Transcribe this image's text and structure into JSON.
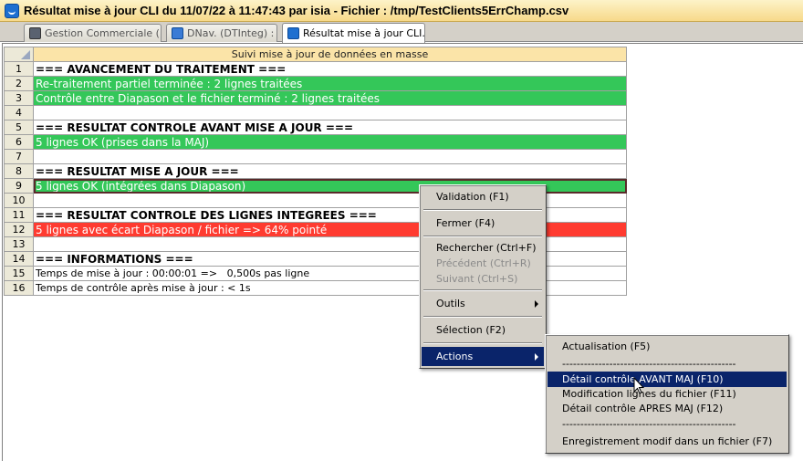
{
  "window": {
    "title": "Résultat mise à jour CLI du 11/07/22 à 11:47:43 par isia - Fichier : /tmp/TestClients5ErrChamp.csv"
  },
  "tabs": [
    {
      "label": "Gestion Commerciale (1..."
    },
    {
      "label": "DNav. (DTInteg) :"
    },
    {
      "label": "Résultat mise à jour CLI..."
    }
  ],
  "grid": {
    "header": "Suivi mise à jour de données en masse",
    "rows": [
      {
        "n": "1",
        "text": "=== AVANCEMENT DU TRAITEMENT ==="
      },
      {
        "n": "2",
        "text": "Re-traitement partiel terminée : 2 lignes traitées"
      },
      {
        "n": "3",
        "text": "Contrôle entre Diapason et le fichier terminé : 2 lignes traitées"
      },
      {
        "n": "4",
        "text": ""
      },
      {
        "n": "5",
        "text": "=== RESULTAT CONTROLE AVANT MISE A JOUR ==="
      },
      {
        "n": "6",
        "text": "5 lignes OK (prises dans la MAJ)"
      },
      {
        "n": "7",
        "text": ""
      },
      {
        "n": "8",
        "text": "=== RESULTAT MISE A JOUR ==="
      },
      {
        "n": "9",
        "text": "5 lignes OK (intégrées dans Diapason)"
      },
      {
        "n": "10",
        "text": ""
      },
      {
        "n": "11",
        "text": "=== RESULTAT CONTROLE DES LIGNES INTEGREES ==="
      },
      {
        "n": "12",
        "text": "5 lignes avec écart Diapason / fichier => 64% pointé"
      },
      {
        "n": "13",
        "text": ""
      },
      {
        "n": "14",
        "text": "=== INFORMATIONS ==="
      },
      {
        "n": "15",
        "text": "Temps de mise à jour : 00:00:01 =>   0,500s pas ligne"
      },
      {
        "n": "16",
        "text": "Temps de contrôle après mise à jour : < 1s"
      }
    ]
  },
  "context_menu": {
    "items": [
      {
        "label": "Validation (F1)"
      },
      {
        "label": "Fermer (F4)"
      },
      {
        "label": "Rechercher (Ctrl+F)"
      },
      {
        "label": "Précédent (Ctrl+R)"
      },
      {
        "label": "Suivant (Ctrl+S)"
      },
      {
        "label": "Outils"
      },
      {
        "label": "Sélection (F2)"
      },
      {
        "label": "Actions"
      }
    ]
  },
  "actions_submenu": {
    "items": [
      {
        "label": "Actualisation  (F5)"
      },
      {
        "label": "------------------------------------------------"
      },
      {
        "label": "Détail contrôle AVANT MAJ  (F10)"
      },
      {
        "label": "Modification lignes du fichier  (F11)"
      },
      {
        "label": "Détail contrôle APRES MAJ  (F12)"
      },
      {
        "label": "------------------------------------------------"
      },
      {
        "label": "Enregistrement modif dans un fichier  (F7)"
      }
    ]
  },
  "colors": {
    "ok_row": "#34c759",
    "error_row": "#ff3b30",
    "header": "#fbe4a8",
    "menu_highlight": "#0a246a"
  }
}
